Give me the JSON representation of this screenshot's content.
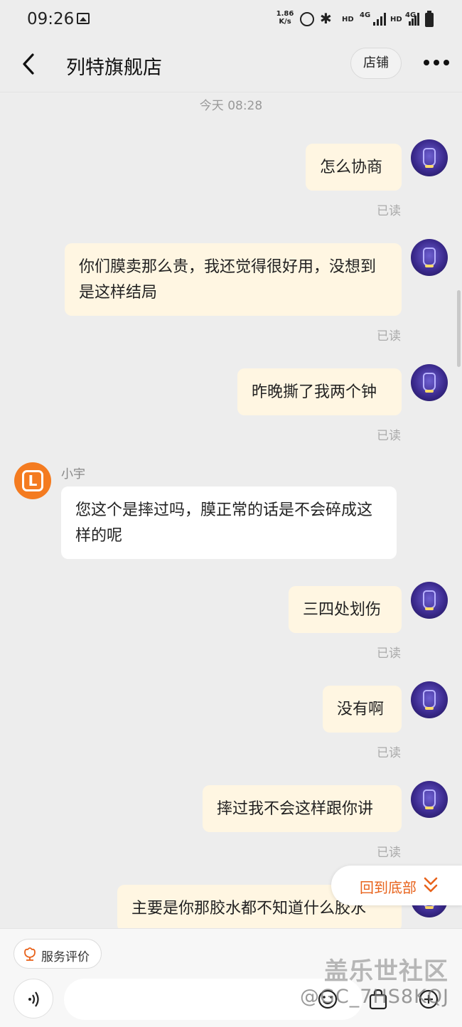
{
  "status_bar": {
    "time": "09:26",
    "speed": "1.86\nK/s",
    "hd1": "HD",
    "net1": "4G",
    "hd2": "HD",
    "net2": "4G"
  },
  "header": {
    "title": "列特旗舰店",
    "shop_button": "店铺"
  },
  "chat": {
    "timestamp": "今天  08:28",
    "read_label": "已读",
    "sender_name": "小宇",
    "sender_avatar_letter": "L",
    "messages": [
      {
        "dir": "out",
        "text": "怎么协商"
      },
      {
        "dir": "out",
        "text": "你们膜卖那么贵，我还觉得很好用，没想到是这样结局"
      },
      {
        "dir": "out",
        "text": "昨晚撕了我两个钟"
      },
      {
        "dir": "in",
        "text": "您这个是摔过吗，膜正常的话是不会碎成这样的呢"
      },
      {
        "dir": "out",
        "text": "三四处划伤"
      },
      {
        "dir": "out",
        "text": "没有啊"
      },
      {
        "dir": "out",
        "text": "摔过我不会这样跟你讲"
      },
      {
        "dir": "out",
        "text": "主要是你那胶水都不知道什么胶水"
      }
    ]
  },
  "back_to_bottom": "回到底部",
  "bottom_bar": {
    "service_label": "服务评价",
    "input_placeholder": ""
  },
  "watermark": {
    "line1": "盖乐世社区",
    "line2": "@GC_7HS8KQJ"
  },
  "colors": {
    "outgoing_bubble": "#fff6e2",
    "incoming_bubble": "#ffffff",
    "accent": "#e8631c",
    "sender_avatar": "#f47b20"
  }
}
